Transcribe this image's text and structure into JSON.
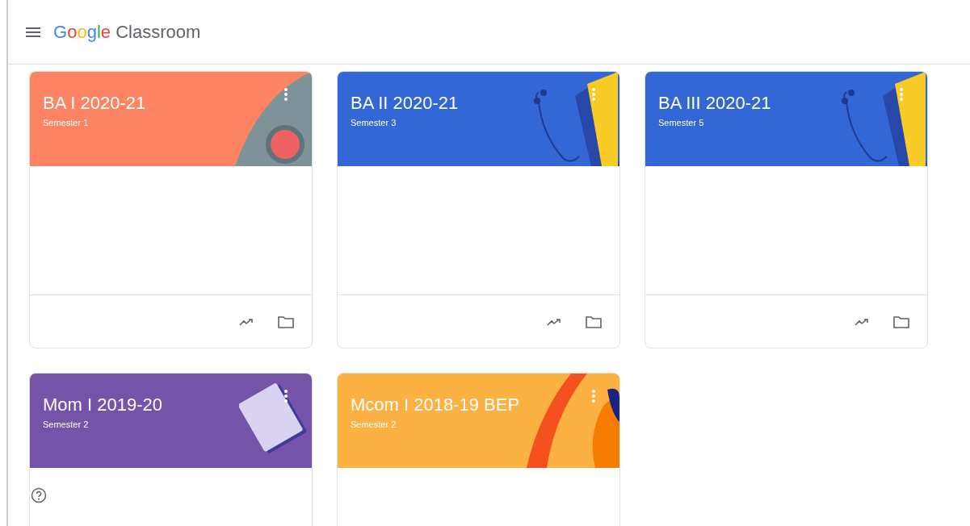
{
  "header": {
    "brand": "Google",
    "product": "Classroom"
  },
  "classes": [
    {
      "name": "BA I 2020-21",
      "section": "Semester 1",
      "color": "#fd8462",
      "kind": "record"
    },
    {
      "name": "BA II 2020-21",
      "section": "Semester 3",
      "color": "#3367d6",
      "kind": "book"
    },
    {
      "name": "BA III 2020-21",
      "section": "Semester 5",
      "color": "#3367d6",
      "kind": "book"
    },
    {
      "name": "Mom I 2019-20",
      "section": "Semester 2",
      "color": "#7454a8",
      "kind": "notebook"
    },
    {
      "name": "Mcom I 2018-19 BEP",
      "section": "Semester 2",
      "color": "#fbb242",
      "kind": "stripe"
    }
  ]
}
